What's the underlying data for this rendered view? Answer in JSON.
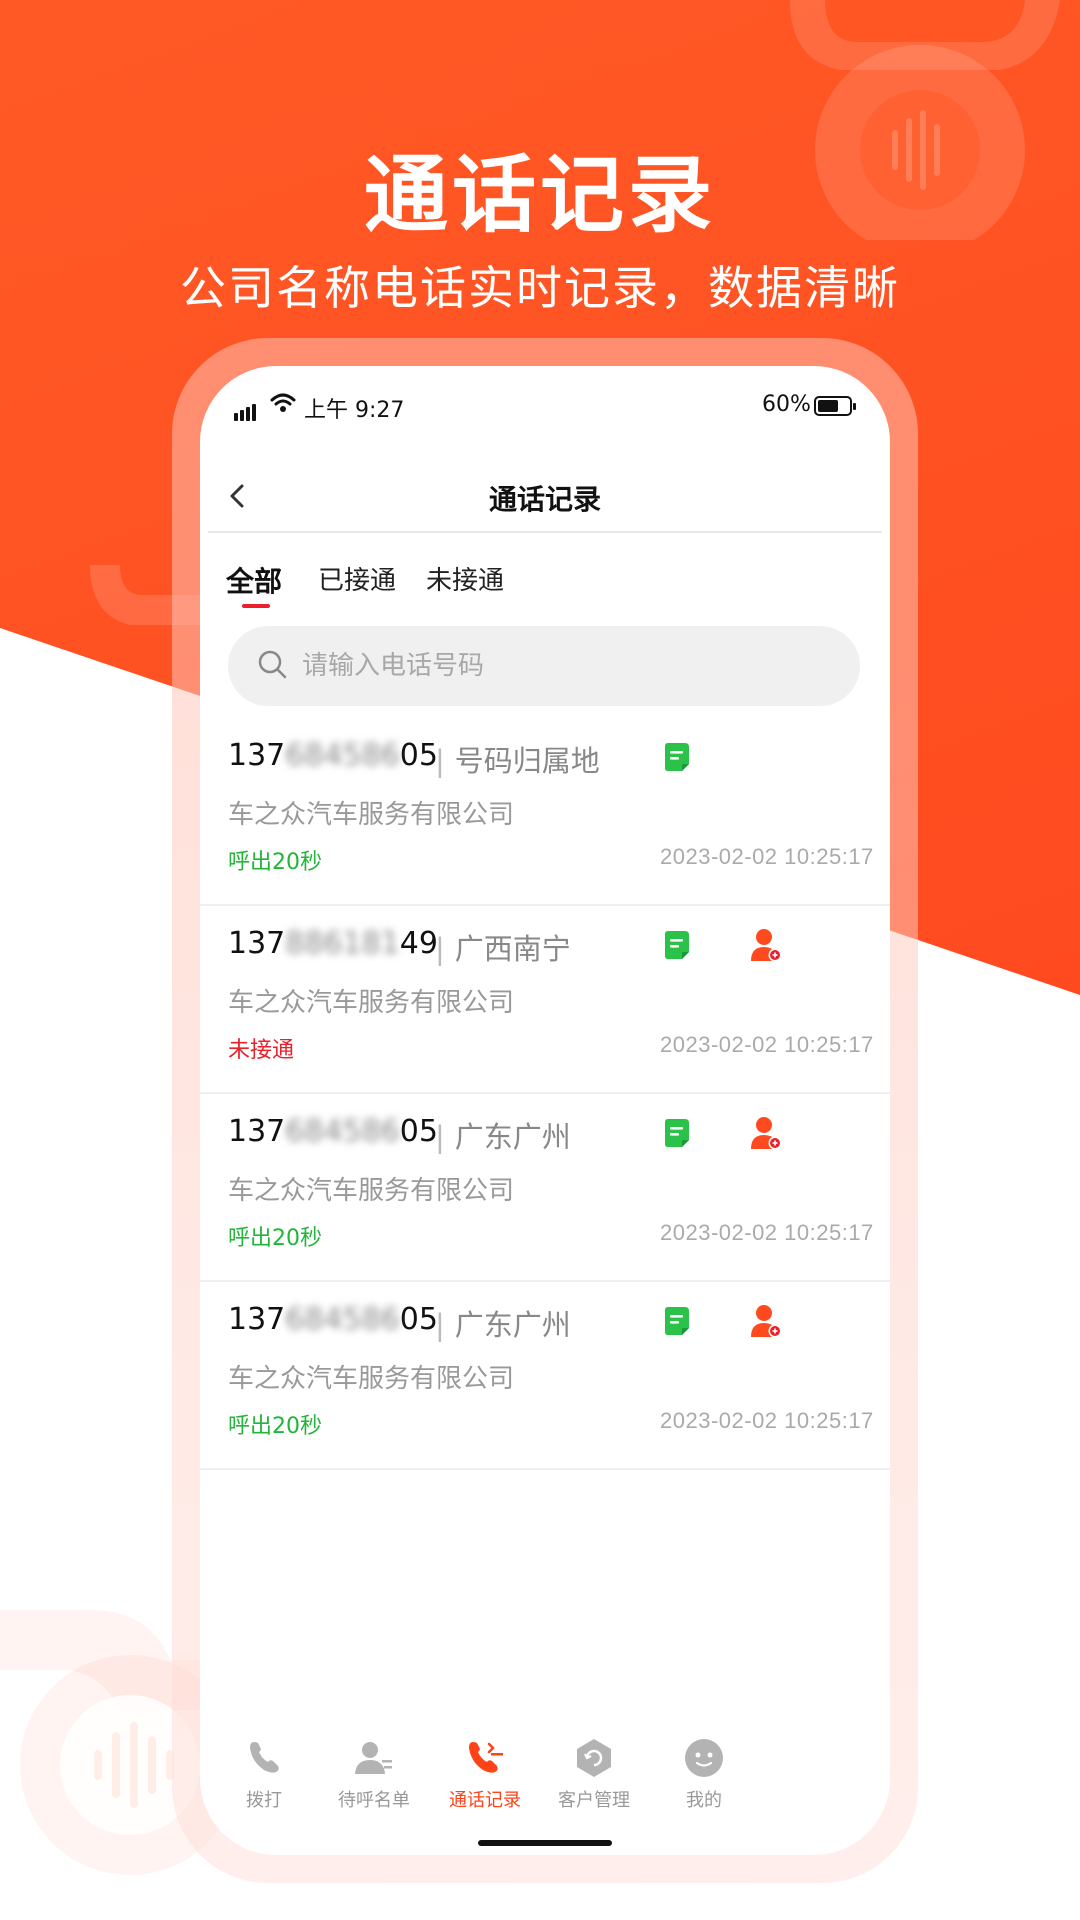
{
  "promo": {
    "headline": "通话记录",
    "subheadline": "公司名称电话实时记录，数据清晰"
  },
  "status_bar": {
    "time": "上午 9:27",
    "battery": "60%"
  },
  "nav": {
    "title": "通话记录"
  },
  "tabs": [
    {
      "label": "全部",
      "active": true
    },
    {
      "label": "已接通",
      "active": false
    },
    {
      "label": "未接通",
      "active": false
    }
  ],
  "search": {
    "placeholder": "请输入电话号码"
  },
  "records": [
    {
      "number_prefix": "137",
      "number_hidden": "684586",
      "number_suffix": "05",
      "separator": "|",
      "region": "号码归属地",
      "company": "车之众汽车服务有限公司",
      "status": "呼出20秒",
      "status_color": "#22b53a",
      "timestamp": "2023-02-02 10:25:17",
      "has_add_contact": false
    },
    {
      "number_prefix": "137",
      "number_hidden": "886181",
      "number_suffix": "49",
      "separator": "|",
      "region": "广西南宁",
      "company": "车之众汽车服务有限公司",
      "status": "未接通",
      "status_color": "#e8212b",
      "timestamp": "2023-02-02 10:25:17",
      "has_add_contact": true
    },
    {
      "number_prefix": "137",
      "number_hidden": "684586",
      "number_suffix": "05",
      "separator": "|",
      "region": "广东广州",
      "company": "车之众汽车服务有限公司",
      "status": "呼出20秒",
      "status_color": "#22b53a",
      "timestamp": "2023-02-02 10:25:17",
      "has_add_contact": true
    },
    {
      "number_prefix": "137",
      "number_hidden": "684586",
      "number_suffix": "05",
      "separator": "|",
      "region": "广东广州",
      "company": "车之众汽车服务有限公司",
      "status": "呼出20秒",
      "status_color": "#22b53a",
      "timestamp": "2023-02-02 10:25:17",
      "has_add_contact": true
    }
  ],
  "tabbar": [
    {
      "label": "拨打",
      "icon": "phone-icon",
      "active": false
    },
    {
      "label": "待呼名单",
      "icon": "call-list-icon",
      "active": false
    },
    {
      "label": "通话记录",
      "icon": "call-log-icon",
      "active": true
    },
    {
      "label": "客户管理",
      "icon": "customer-icon",
      "active": false
    },
    {
      "label": "我的",
      "icon": "profile-icon",
      "active": false
    }
  ],
  "colors": {
    "brand": "#ff4a1f",
    "accent_red": "#e8212b",
    "success_green": "#22b53a"
  }
}
